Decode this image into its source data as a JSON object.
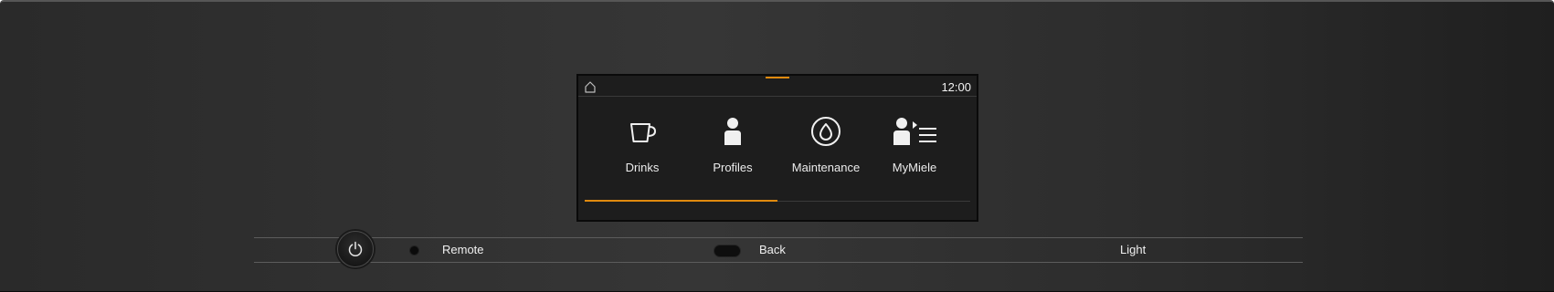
{
  "status_bar": {
    "time": "12:00",
    "home_icon": "home-icon"
  },
  "menu": {
    "items": [
      {
        "label": "Drinks",
        "icon": "cup-icon"
      },
      {
        "label": "Profiles",
        "icon": "person-icon"
      },
      {
        "label": "Maintenance",
        "icon": "droplet-icon"
      },
      {
        "label": "MyMiele",
        "icon": "person-list-icon"
      }
    ],
    "page_position_fraction": 0.5
  },
  "controls": {
    "power_icon": "power-icon",
    "remote_label": "Remote",
    "back_label": "Back",
    "light_label": "Light"
  },
  "colors": {
    "accent": "#e08a0e",
    "panel": "#2e2e2e",
    "screen": "#1d1d1d",
    "text": "#f0f0f0"
  }
}
